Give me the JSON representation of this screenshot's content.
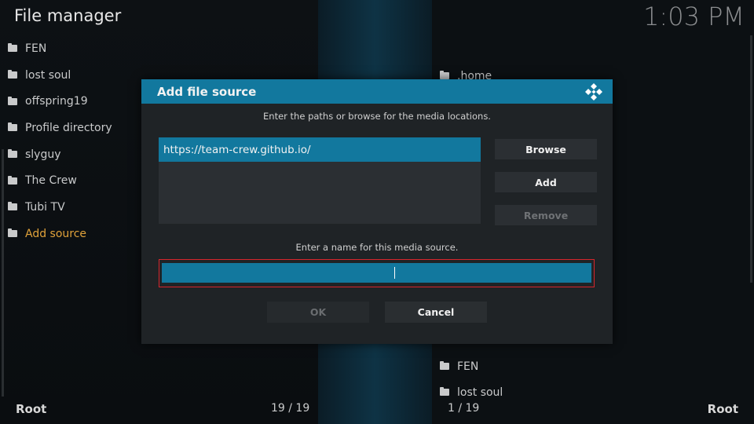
{
  "app": {
    "title": "File manager",
    "clock": "1:03 PM"
  },
  "left_list": {
    "items": [
      {
        "label": "FEN"
      },
      {
        "label": "lost soul"
      },
      {
        "label": "offspring19"
      },
      {
        "label": "Profile directory"
      },
      {
        "label": "slyguy"
      },
      {
        "label": "The Crew"
      },
      {
        "label": "Tubi TV"
      },
      {
        "label": "Add source"
      }
    ]
  },
  "right_list": {
    "top_item": ".home",
    "bottom_items": [
      "FEN",
      "lost soul"
    ]
  },
  "footer": {
    "left_label": "Root",
    "left_count": "19 / 19",
    "right_count": "1 / 19",
    "right_label": "Root"
  },
  "dialog": {
    "title": "Add file source",
    "paths_hint": "Enter the paths or browse for the media locations.",
    "paths": [
      "https://team-crew.github.io/"
    ],
    "browse_label": "Browse",
    "add_label": "Add",
    "remove_label": "Remove",
    "name_hint": "Enter a name for this media source.",
    "name_value": "",
    "ok_label": "OK",
    "cancel_label": "Cancel"
  },
  "colors": {
    "accent": "#12789e",
    "highlight": "#e0a23a",
    "focus_border": "#d6262c"
  }
}
